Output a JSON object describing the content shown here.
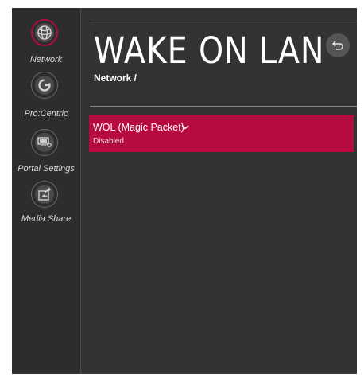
{
  "sidebar": {
    "items": [
      {
        "label": "Network",
        "icon": "globe-icon",
        "active": true
      },
      {
        "label": "Pro:Centric",
        "icon": "pro-centric-icon",
        "active": false
      },
      {
        "label": "Portal Settings",
        "icon": "portal-settings-icon",
        "active": false
      },
      {
        "label": "Media Share",
        "icon": "media-share-icon",
        "active": false
      }
    ]
  },
  "header": {
    "title": "WAKE ON LAN",
    "breadcrumb": "Network /",
    "back_icon": "back-arrow-icon"
  },
  "options": [
    {
      "label": "WOL (Magic Packet)",
      "value": "Disabled",
      "icon": "chevron-down-icon",
      "selected": true
    }
  ],
  "colors": {
    "accent": "#b60b3f",
    "panel": "#333333",
    "sidebar": "#2d2d2d"
  }
}
